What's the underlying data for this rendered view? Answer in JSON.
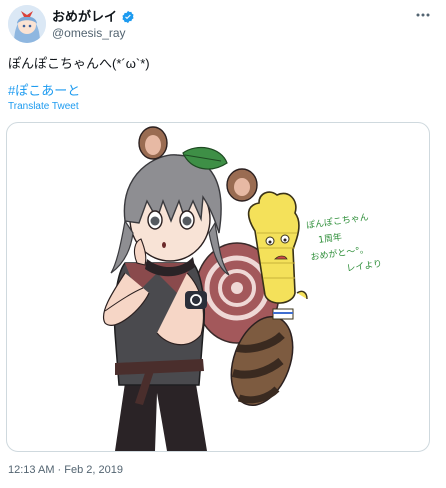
{
  "user": {
    "display_name": "おめがレイ",
    "handle": "@omesis_ray",
    "verified": true
  },
  "tweet": {
    "text": "ぽんぽこちゃんへ(*´ω`*)",
    "hashtag": "#ぽこあーと",
    "translate_label": "Translate Tweet",
    "timestamp": "12:13 AM · Feb 2, 2019"
  },
  "image": {
    "handwritten_note": [
      "ぽんぽこちゃん",
      "1周年",
      "おめがと～°。",
      "レイより"
    ]
  },
  "colors": {
    "link": "#1d9bf0",
    "secondary_text": "#536471",
    "border": "#cfd9de",
    "verified": "#1d9bf0"
  }
}
